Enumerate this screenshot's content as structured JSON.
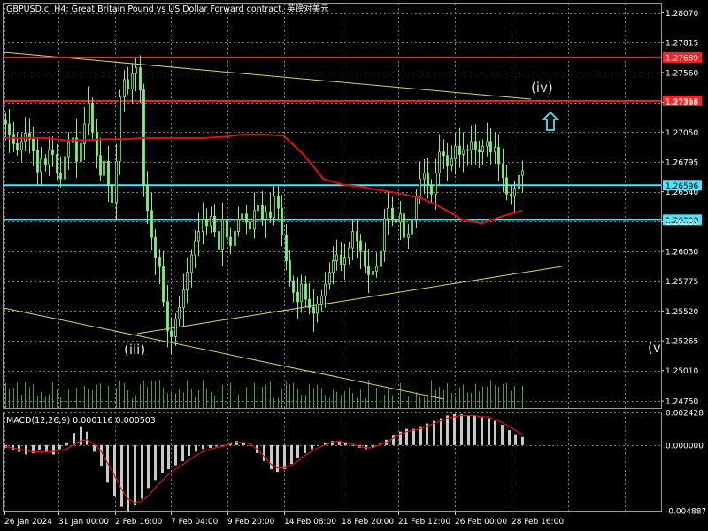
{
  "header": {
    "title": "GBPUSD.c, H4:  Great Britain Pound vs US Dollar Forward contract, 英镑对美元"
  },
  "macd": {
    "label": "MACD(12,26,9) 0.000116 0.000503",
    "ticks": [
      "0.002428",
      "0.000000",
      "-0.004887"
    ]
  },
  "colors": {
    "background": "#000000",
    "grid": "#7a7a7a",
    "candle": "#7ef27e",
    "moving_average": "#e01010",
    "hline_red": "#ff2020",
    "hline_cyan": "#4fe2ff",
    "trendline": "#d8d36a",
    "macd_hist": "#c8c8c8",
    "macd_signal": "#e01010",
    "arrow": "#41e4ff"
  },
  "icons": {
    "target_arrow": "up-arrow-icon"
  },
  "chart_data": {
    "type": "candlestick",
    "symbol": "GBPUSD.c",
    "timeframe": "H4",
    "x_ticks": [
      "26 Jan 2024",
      "31 Jan 00:00",
      "2 Feb 16:00",
      "7 Feb 04:00",
      "9 Feb 20:00",
      "14 Feb 08:00",
      "18 Feb 20:00",
      "21 Feb 12:00",
      "26 Feb 00:00",
      "28 Feb 16:00"
    ],
    "y_ticks": [
      1.2807,
      1.27815,
      1.2756,
      1.27305,
      1.2705,
      1.26795,
      1.2654,
      1.26285,
      1.2603,
      1.25775,
      1.2552,
      1.25265,
      1.2501,
      1.2475
    ],
    "ylim": [
      1.2469,
      1.2815
    ],
    "grid": true,
    "price_lines": [
      {
        "label": "1.27689",
        "value": 1.27689,
        "color": "red"
      },
      {
        "label": "1.27318",
        "value": 1.27318,
        "color": "red"
      },
      {
        "label": "1.26596",
        "value": 1.26596,
        "color": "cyan"
      },
      {
        "label": "1.26300",
        "value": 1.263,
        "color": "cyan"
      }
    ],
    "wave_labels": [
      "(iii)",
      "(iv)",
      "(v"
    ],
    "closes": [
      1.2712,
      1.2703,
      1.2695,
      1.269,
      1.2697,
      1.2704,
      1.2699,
      1.2689,
      1.2671,
      1.2682,
      1.2677,
      1.269,
      1.2686,
      1.267,
      1.2665,
      1.2684,
      1.2696,
      1.27,
      1.268,
      1.2695,
      1.2712,
      1.273,
      1.2705,
      1.2685,
      1.2668,
      1.268,
      1.266,
      1.2645,
      1.268,
      1.2735,
      1.275,
      1.2742,
      1.2755,
      1.276,
      1.2741,
      1.266,
      1.2638,
      1.2615,
      1.2598,
      1.259,
      1.256,
      1.2535,
      1.253,
      1.2545,
      1.2555,
      1.257,
      1.2585,
      1.26,
      1.2612,
      1.262,
      1.263,
      1.2625,
      1.2633,
      1.262,
      1.2605,
      1.263,
      1.2615,
      1.2608,
      1.262,
      1.263,
      1.2635,
      1.2628,
      1.2622,
      1.2638,
      1.2642,
      1.263,
      1.2637,
      1.2632,
      1.265,
      1.264,
      1.2617,
      1.2595,
      1.2578,
      1.2568,
      1.256,
      1.2575,
      1.2562,
      1.2555,
      1.255,
      1.2558,
      1.2565,
      1.2575,
      1.2585,
      1.2595,
      1.26,
      1.2592,
      1.2598,
      1.2606,
      1.262,
      1.2612,
      1.2603,
      1.259,
      1.2583,
      1.2586,
      1.259,
      1.2603,
      1.2631,
      1.264,
      1.263,
      1.2628,
      1.2635,
      1.2615,
      1.2618,
      1.263,
      1.265,
      1.2665,
      1.267,
      1.266,
      1.2652,
      1.267,
      1.2688,
      1.2685,
      1.2676,
      1.2682,
      1.2693,
      1.2686,
      1.269,
      1.269,
      1.2697,
      1.269,
      1.2688,
      1.2693,
      1.2697,
      1.2688,
      1.2692,
      1.2678,
      1.2666,
      1.2652,
      1.265,
      1.2657,
      1.2668,
      1.2672
    ],
    "ma_values": [
      1.27,
      1.27,
      1.27,
      1.2698,
      1.2698,
      1.2699,
      1.2699,
      1.27,
      1.27,
      1.27,
      1.27,
      1.2701,
      1.2703,
      1.2703,
      1.2702,
      1.2686,
      1.2665,
      1.266,
      1.2658,
      1.2655,
      1.2652,
      1.2648,
      1.264,
      1.263,
      1.2627,
      1.2633,
      1.2638
    ],
    "macd": {
      "main_hist": [
        -0.0002,
        -0.0004,
        -0.0005,
        -0.0007,
        -0.0006,
        -0.0004,
        -0.0005,
        -0.0007,
        -0.0003,
        0.0002,
        0.0009,
        0.0014,
        0.001,
        -0.0005,
        -0.0016,
        -0.0028,
        -0.0038,
        -0.0046,
        -0.0049,
        -0.0045,
        -0.004,
        -0.0032,
        -0.0026,
        -0.0021,
        -0.0018,
        -0.0015,
        -0.0012,
        -0.0008,
        -0.0005,
        -0.0003,
        -0.0002,
        -0.0001,
        0.0,
        0.0002,
        0.0003,
        0.0002,
        0.0,
        -0.0006,
        -0.0012,
        -0.0018,
        -0.002,
        -0.0018,
        -0.0014,
        -0.001,
        -0.0006,
        -0.0003,
        0.0,
        0.0002,
        0.0003,
        0.0003,
        0.0002,
        0.0,
        -0.0002,
        -0.0003,
        -0.0002,
        0.0001,
        0.0004,
        0.0007,
        0.001,
        0.0012,
        0.0012,
        0.0014,
        0.0016,
        0.0018,
        0.002,
        0.0022,
        0.0023,
        0.0023,
        0.0022,
        0.0022,
        0.0021,
        0.002,
        0.0018,
        0.0015,
        0.0011,
        0.0008,
        0.0006
      ],
      "signal": [
        -0.0001,
        -0.0002,
        -0.0003,
        -0.0004,
        -0.0005,
        -0.0005,
        -0.0005,
        -0.0005,
        -0.0004,
        -0.0003,
        0.0,
        0.0003,
        0.0004,
        0.0001,
        -0.0004,
        -0.0013,
        -0.0022,
        -0.0032,
        -0.004,
        -0.0043,
        -0.0042,
        -0.0038,
        -0.0032,
        -0.0027,
        -0.0022,
        -0.0018,
        -0.0015,
        -0.0011,
        -0.0008,
        -0.0005,
        -0.0003,
        -0.0002,
        -0.0001,
        0.0001,
        0.0002,
        0.0002,
        0.0001,
        -0.0003,
        -0.0008,
        -0.0014,
        -0.0017,
        -0.0017,
        -0.0015,
        -0.0012,
        -0.0008,
        -0.0005,
        -0.0002,
        0.0,
        0.0002,
        0.0003,
        0.0002,
        0.0001,
        -0.0001,
        -0.0002,
        -0.0002,
        0.0,
        0.0002,
        0.0005,
        0.0008,
        0.001,
        0.0011,
        0.0012,
        0.0014,
        0.0016,
        0.0018,
        0.002,
        0.0021,
        0.0022,
        0.0022,
        0.0022,
        0.0021,
        0.0021,
        0.0019,
        0.0017,
        0.0014,
        0.0011,
        0.0008
      ]
    },
    "macd_ylim": [
      -0.004887,
      0.002428
    ]
  }
}
